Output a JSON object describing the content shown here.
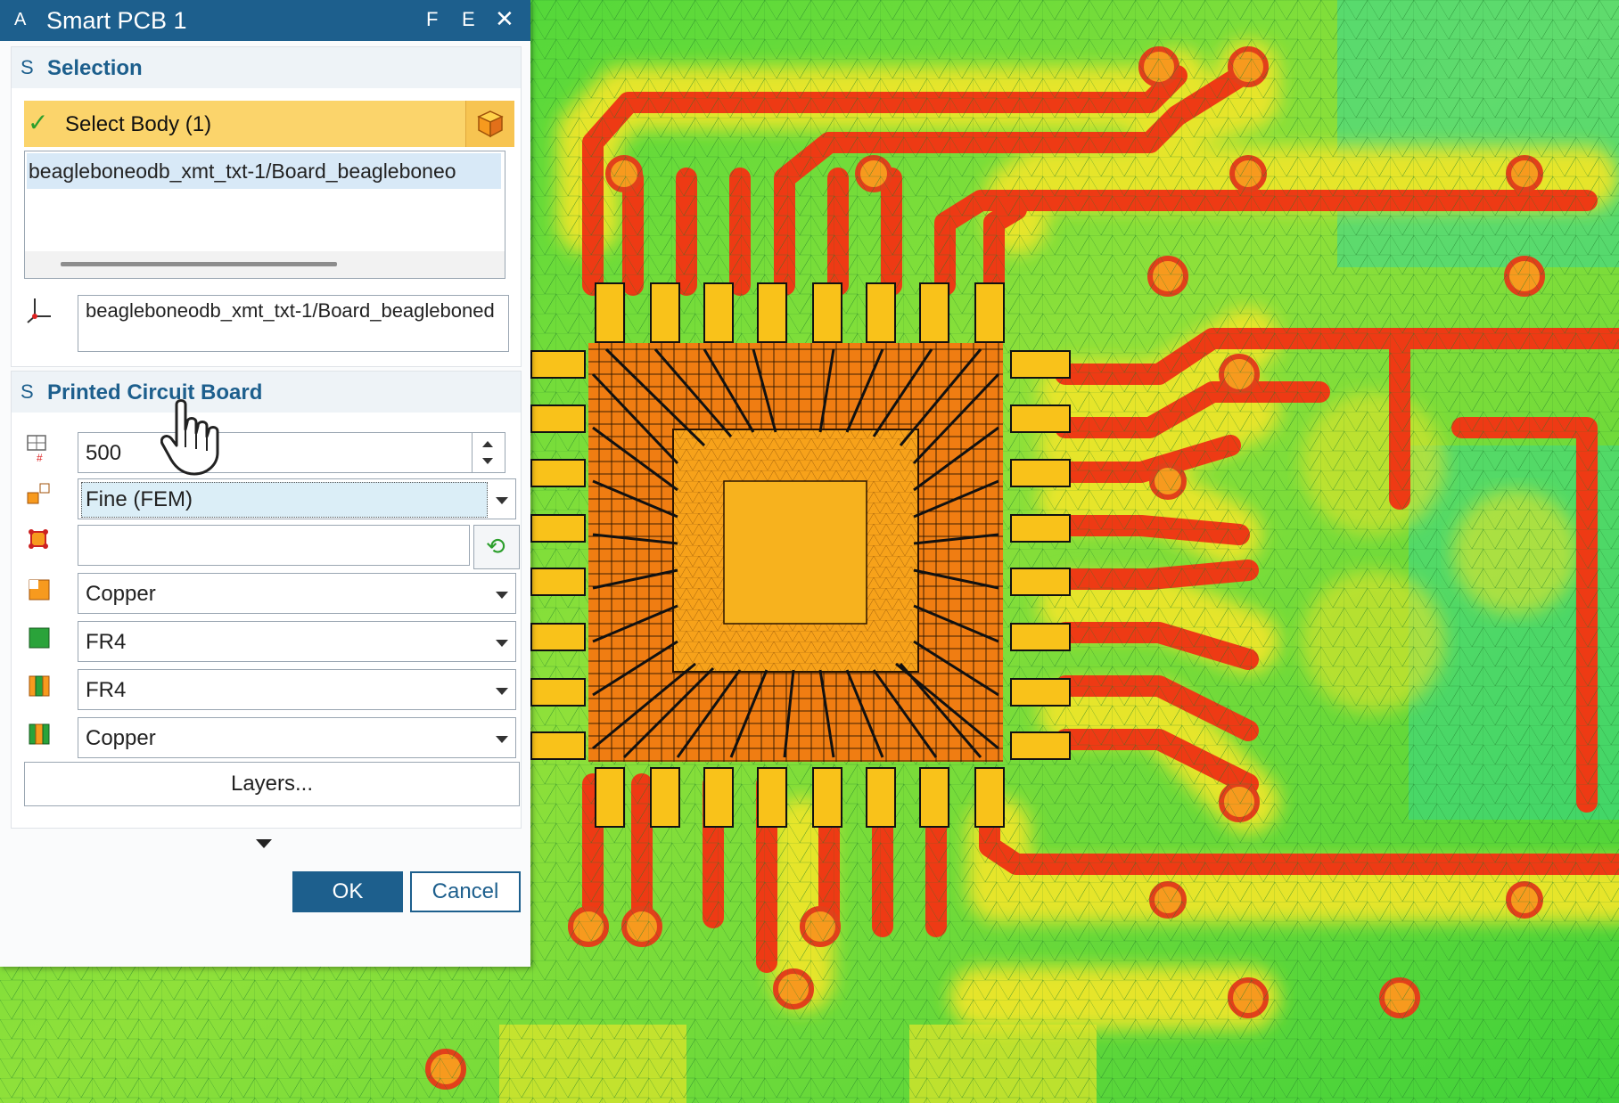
{
  "dialog": {
    "title": "Smart PCB 1",
    "title_icon": "A",
    "title_buttons": [
      "F",
      "E",
      "✕"
    ]
  },
  "selection": {
    "caret": "S",
    "title": "Selection",
    "select_label": "Select Body (1)",
    "list_item": "beagleboneodb_xmt_txt-1/Board_beagleboneo",
    "path_value": "beagleboneodb_xmt_txt-1/Board_beagleboned"
  },
  "pcb": {
    "caret": "S",
    "title": "Printed Circuit Board",
    "element_count": "500",
    "mesh_quality": "Fine (FEM)",
    "empty_field": "",
    "top_layer": "Copper",
    "board_material": "FR4",
    "inner_material": "FR4",
    "bottom_layer": "Copper",
    "layers_button": "Layers..."
  },
  "footer": {
    "ok": "OK",
    "cancel": "Cancel"
  },
  "icons": {
    "select": "cube-icon",
    "csys": "coordinate-system-icon",
    "grid": "mesh-grid-icon",
    "quality": "mesh-quality-icon",
    "node": "node-icon",
    "refresh": "refresh-icon",
    "copper": "copper-layer-icon",
    "board": "board-material-icon",
    "stack": "layer-stack-icon"
  },
  "colors": {
    "accent": "#1d5f8d",
    "highlight": "#fbd46b"
  }
}
